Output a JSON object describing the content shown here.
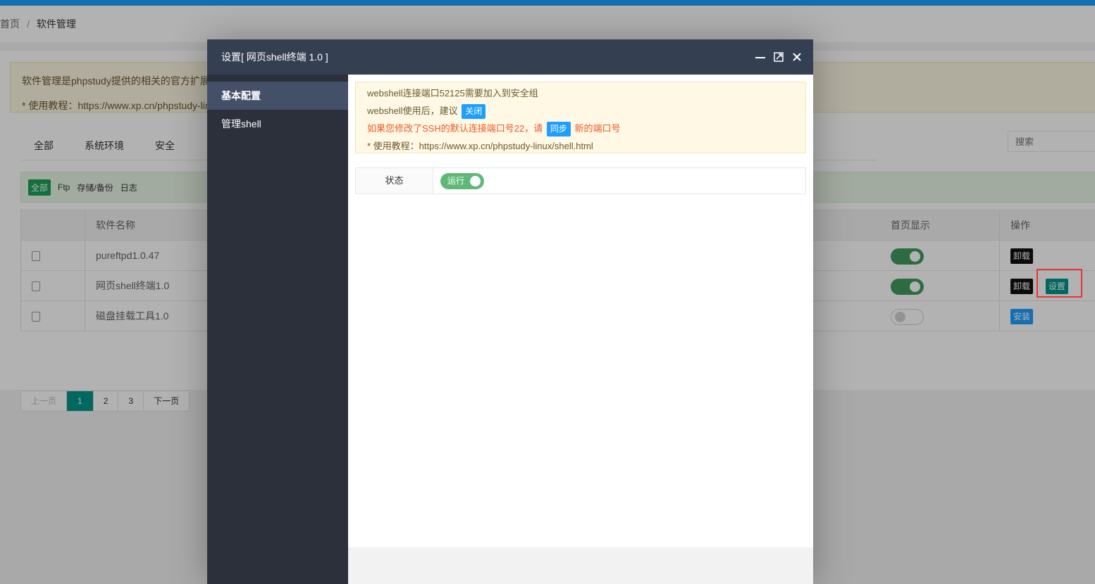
{
  "breadcrumb": {
    "home": "首页",
    "sep": "/",
    "current": "软件管理"
  },
  "notice": {
    "line1": "软件管理是phpstudy提供的相关的官方扩展",
    "line2": "* 使用教程：https://www.xp.cn/phpstudy-lin"
  },
  "tabs": [
    "全部",
    "系统环境",
    "安全"
  ],
  "search": {
    "placeholder": "搜索"
  },
  "filters": [
    "全部",
    "Ftp",
    "存储/备份",
    "日志"
  ],
  "table": {
    "headers": {
      "name": "软件名称",
      "home": "首页显示",
      "ops": "操作"
    },
    "rows": [
      {
        "name": "pureftpd1.0.47",
        "home_on": true,
        "btn1": "卸载",
        "btn2": ""
      },
      {
        "name": "网页shell终端1.0",
        "home_on": true,
        "btn1": "卸载",
        "btn2": "设置"
      },
      {
        "name": "磁盘挂载工具1.0",
        "home_on": false,
        "btn1": "安装",
        "btn2": ""
      }
    ]
  },
  "pager": {
    "prev": "上一页",
    "pages": [
      "1",
      "2",
      "3"
    ],
    "next": "下一页",
    "current": "1"
  },
  "modal": {
    "title": "设置[ 网页shell终端 1.0 ]",
    "menu": [
      "基本配置",
      "管理shell"
    ],
    "tip": {
      "line1": "webshell连接端口52125需要加入到安全组",
      "line2_pre": "webshell使用后，建议",
      "line2_tag": "关闭",
      "line3_pre": "如果您修改了SSH的默认连接端口号22，请",
      "line3_tag": "同步",
      "line3_post": "新的端口号",
      "line4": "* 使用教程：https://www.xp.cn/phpstudy-linux/shell.html"
    },
    "status_label": "状态",
    "status_value": "运行"
  },
  "colors": {
    "accent": "#1e9fff",
    "teal": "#009688",
    "green": "#5fb878",
    "modal_header": "#353f52",
    "sidebar": "#2b303b"
  }
}
